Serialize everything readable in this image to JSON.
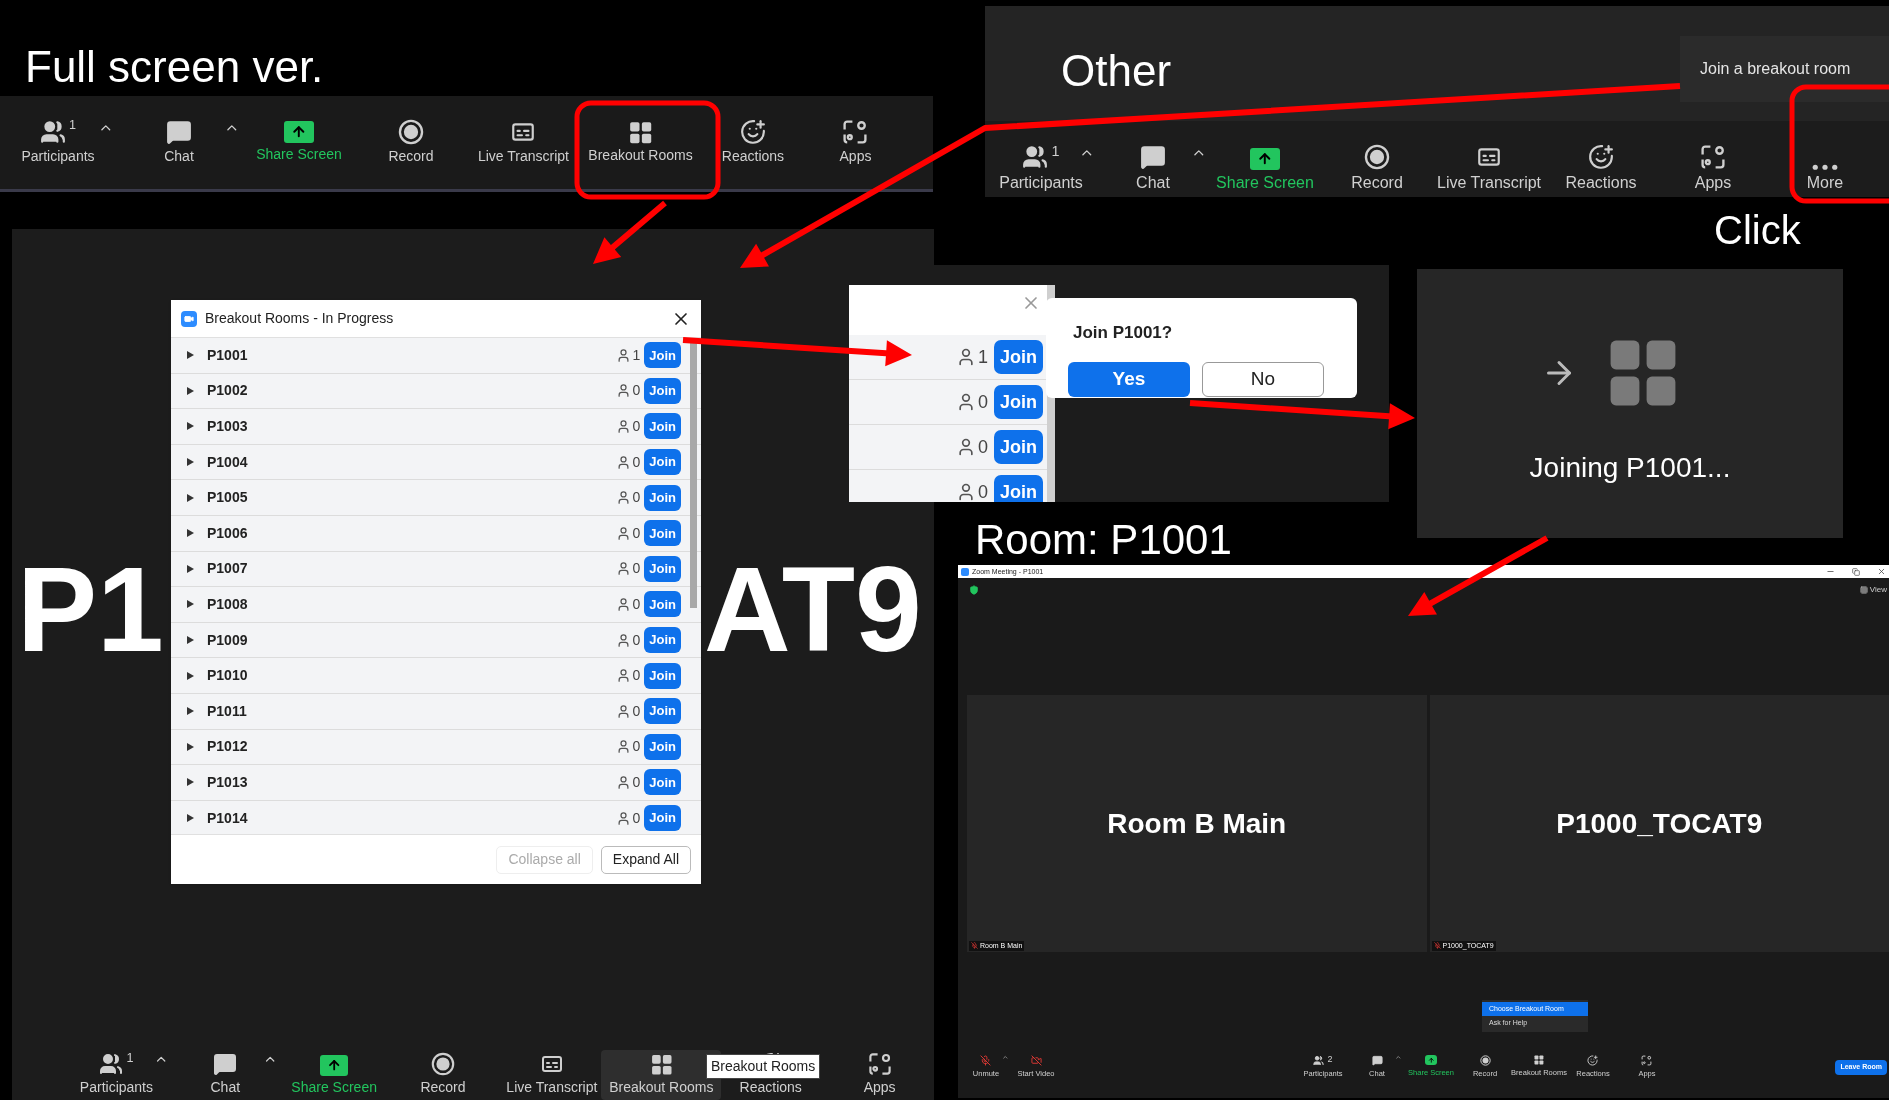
{
  "slide_title": "Full screen ver.",
  "fullscreen_toolbar": {
    "items": [
      {
        "kind": "participants",
        "label": "Participants",
        "count": "1",
        "caret": true
      },
      {
        "kind": "chat",
        "label": "Chat",
        "caret": true
      },
      {
        "kind": "share",
        "label": "Share Screen",
        "caret": false
      },
      {
        "kind": "record",
        "label": "Record",
        "caret": false
      },
      {
        "kind": "transcript",
        "label": "Live Transcript",
        "caret": false
      },
      {
        "kind": "breakout",
        "label": "Breakout Rooms",
        "caret": false
      },
      {
        "kind": "reactions",
        "label": "Reactions",
        "caret": false
      },
      {
        "kind": "apps",
        "label": "Apps",
        "caret": false
      }
    ]
  },
  "background_name": [
    "P1",
    "AT9"
  ],
  "breakout_dialog": {
    "title": "Breakout Rooms - In Progress",
    "rooms": [
      {
        "name": "P1001",
        "count": "1",
        "join": "Join",
        "expanded": false
      },
      {
        "name": "P1002",
        "count": "0",
        "join": "Join",
        "expanded": false
      },
      {
        "name": "P1003",
        "count": "0",
        "join": "Join",
        "expanded": false
      },
      {
        "name": "P1004",
        "count": "0",
        "join": "Join",
        "expanded": false
      },
      {
        "name": "P1005",
        "count": "0",
        "join": "Join",
        "expanded": false
      },
      {
        "name": "P1006",
        "count": "0",
        "join": "Join",
        "expanded": false
      },
      {
        "name": "P1007",
        "count": "0",
        "join": "Join",
        "expanded": false
      },
      {
        "name": "P1008",
        "count": "0",
        "join": "Join",
        "expanded": false
      },
      {
        "name": "P1009",
        "count": "0",
        "join": "Join",
        "expanded": false
      },
      {
        "name": "P1010",
        "count": "0",
        "join": "Join",
        "expanded": false
      },
      {
        "name": "P1011",
        "count": "0",
        "join": "Join",
        "expanded": false
      },
      {
        "name": "P1012",
        "count": "0",
        "join": "Join",
        "expanded": false
      },
      {
        "name": "P1013",
        "count": "0",
        "join": "Join",
        "expanded": false
      },
      {
        "name": "P1014",
        "count": "0",
        "join": "Join",
        "expanded": false
      }
    ],
    "buttons": [
      {
        "label": "Collapse all",
        "disabled": true
      },
      {
        "label": "Expand All",
        "disabled": false
      }
    ]
  },
  "bottom_toolbar": {
    "tooltip": "Breakout Rooms",
    "items": [
      {
        "kind": "participants",
        "label": "Participants",
        "count": "1",
        "caret": true,
        "selected": false
      },
      {
        "kind": "chat",
        "label": "Chat",
        "caret": true,
        "selected": false
      },
      {
        "kind": "share",
        "label": "Share Screen",
        "caret": false,
        "selected": false
      },
      {
        "kind": "record",
        "label": "Record",
        "caret": false,
        "selected": false
      },
      {
        "kind": "transcript",
        "label": "Live Transcript",
        "caret": false,
        "selected": false
      },
      {
        "kind": "breakout",
        "label": "Breakout Rooms",
        "caret": false,
        "selected": true
      },
      {
        "kind": "reactions",
        "label": "Reactions",
        "caret": false,
        "selected": false
      },
      {
        "kind": "apps",
        "label": "Apps",
        "caret": false,
        "selected": false
      }
    ]
  },
  "other_panel": {
    "title": "Other",
    "tooltip": "Join a breakout room",
    "toolbar": {
      "items": [
        {
          "kind": "participants",
          "label": "Participants",
          "count": "1",
          "caret": true
        },
        {
          "kind": "chat",
          "label": "Chat",
          "caret": true
        },
        {
          "kind": "share",
          "label": "Share Screen",
          "caret": false
        },
        {
          "kind": "record",
          "label": "Record",
          "caret": false
        },
        {
          "kind": "transcript",
          "label": "Live Transcript",
          "caret": false
        },
        {
          "kind": "reactions",
          "label": "Reactions",
          "caret": false
        },
        {
          "kind": "apps",
          "label": "Apps",
          "caret": false
        },
        {
          "kind": "more",
          "label": "More",
          "caret": false
        }
      ]
    }
  },
  "click_label": "Click",
  "join_popup": {
    "rooms": [
      {
        "count": "1",
        "join": "Join"
      },
      {
        "count": "0",
        "join": "Join"
      },
      {
        "count": "0",
        "join": "Join"
      },
      {
        "count": "0",
        "join": "Join"
      }
    ],
    "prompt": "Join P1001?",
    "buttons": [
      {
        "label": "Yes",
        "primary": true
      },
      {
        "label": "No",
        "primary": false
      }
    ]
  },
  "joining_panel": {
    "message": "Joining P1001..."
  },
  "room_label": "Room: P1001",
  "meeting_window": {
    "title": "Zoom Meeting - P1001",
    "view": "View",
    "tiles": [
      {
        "name": "Room B Main",
        "tag": "Room B Main"
      },
      {
        "name": "P1000_TOCAT9",
        "tag": "P1000_TOCAT9"
      }
    ],
    "menu": [
      {
        "label": "Choose Breakout Room",
        "selected": true
      },
      {
        "label": "Ask for Help",
        "selected": false
      }
    ],
    "left_controls": [
      {
        "kind": "unmute",
        "label": "Unmute",
        "caret": true
      },
      {
        "kind": "video",
        "label": "Start Video",
        "caret": false
      }
    ],
    "toolbar": {
      "items": [
        {
          "kind": "participants",
          "label": "Participants",
          "count": "2",
          "caret": false
        },
        {
          "kind": "chat",
          "label": "Chat",
          "caret": true
        },
        {
          "kind": "share",
          "label": "Share Screen",
          "caret": false
        },
        {
          "kind": "record",
          "label": "Record",
          "caret": false
        },
        {
          "kind": "breakout",
          "label": "Breakout Rooms",
          "caret": false
        },
        {
          "kind": "reactions",
          "label": "Reactions",
          "caret": false
        },
        {
          "kind": "apps",
          "label": "Apps",
          "caret": false
        }
      ]
    },
    "leave": "Leave Room"
  }
}
